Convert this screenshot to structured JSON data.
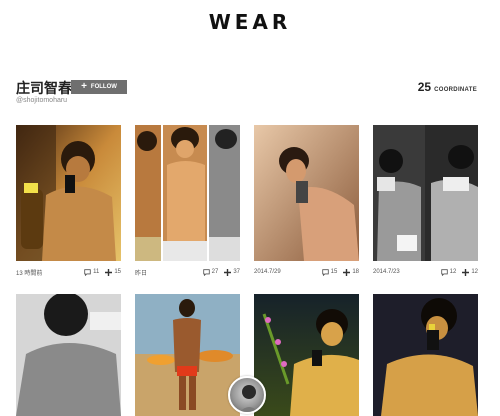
{
  "site": {
    "logo": "WEAR"
  },
  "profile": {
    "name": "庄司智春",
    "handle": "@shojitomoharu",
    "follow_label": "FOLLOW",
    "coordinate_count": "25",
    "coordinate_label": "COORDINATE"
  },
  "posts": [
    {
      "date": "13 時間前",
      "comments": "11",
      "saves": "15"
    },
    {
      "date": "昨日",
      "comments": "27",
      "saves": "37"
    },
    {
      "date": "2014.7/29",
      "comments": "15",
      "saves": "18"
    },
    {
      "date": "2014.7/23",
      "comments": "12",
      "saves": "12"
    },
    {},
    {},
    {},
    {}
  ],
  "icons": {
    "comment": "comment-icon",
    "save": "plus-icon",
    "follow": "plus-icon"
  }
}
